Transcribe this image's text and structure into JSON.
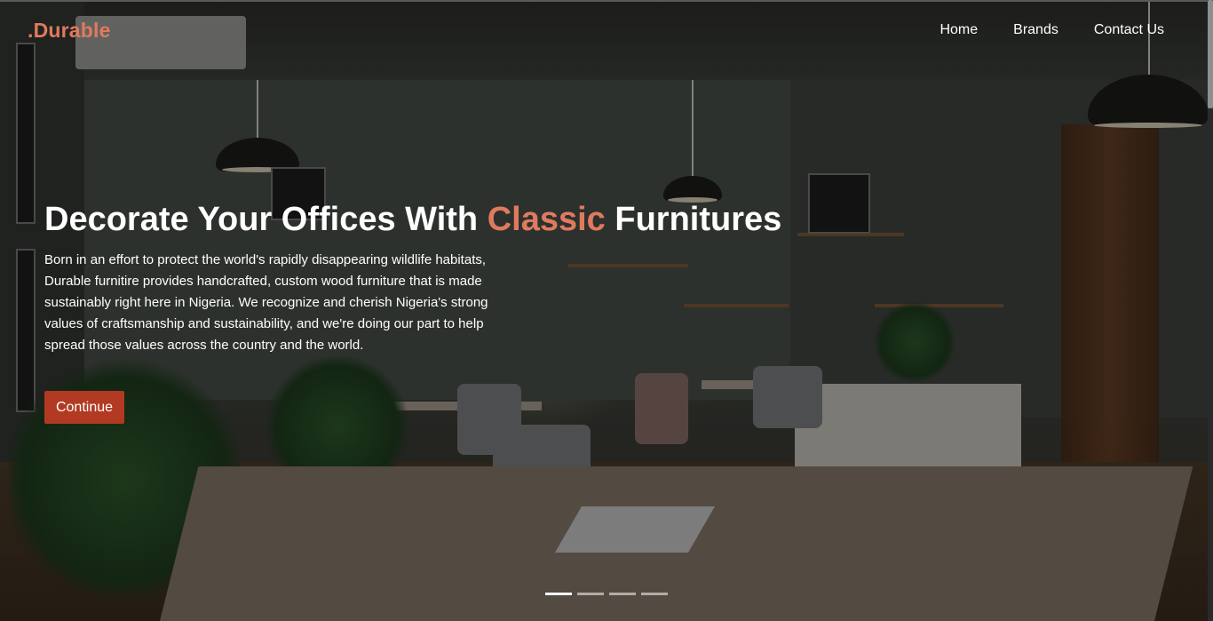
{
  "brand": {
    "logo_text": ".Durable"
  },
  "nav": {
    "items": [
      {
        "label": "Home"
      },
      {
        "label": "Brands"
      },
      {
        "label": "Contact Us"
      }
    ]
  },
  "hero": {
    "title_before": "Decorate Your Offices With ",
    "title_accent": "Classic",
    "title_after": " Furnitures",
    "description": "Born in an effort to protect the world's rapidly disappearing wildlife habitats, Durable furnitire provides handcrafted, custom wood furniture that is made sustainably right here in Nigeria. We recognize and cherish Nigeria's strong values of craftsmanship and sustainability, and we're doing our part to help spread those values across the country and the world.",
    "button_label": "Continue"
  },
  "carousel": {
    "slide_count": 4,
    "active_index": 0
  },
  "colors": {
    "accent": "#e07a5f",
    "button": "#b23a22",
    "text": "#ffffff"
  }
}
